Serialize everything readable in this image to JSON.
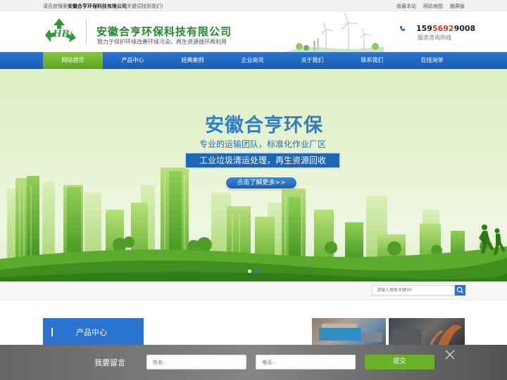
{
  "topbar": {
    "tip_prefix": "请百度搜索",
    "tip_company": "安徽合亨环保科技有限公司",
    "tip_suffix": "关键词找到我们!",
    "links": [
      "收藏本站",
      "网站地图",
      "触屏版"
    ]
  },
  "header": {
    "logo_text": "HB",
    "company_name": "安徽合亨环保科技有限公司",
    "slogan": "致力于保护环境改善环境污染，再生资源循环再利用",
    "phone_part1": "159",
    "phone_part2": "5692",
    "phone_part3": "9008",
    "phone_label": "服务咨询热线"
  },
  "nav": {
    "items": [
      "网站首页",
      "产品中心",
      "经典案例",
      "企业商讯",
      "关于我们",
      "联系我们",
      "在线询单"
    ],
    "active_index": 0
  },
  "banner": {
    "title": "安徽合亨环保",
    "subtitle": "专业的运输团队，标准化作业厂区",
    "box_text": "工业垃圾清运处理，再生资源回收",
    "button_label": "点击了解更多>>",
    "slide_count": 2,
    "active_slide": 1
  },
  "search": {
    "placeholder": "请输入搜索关键词!"
  },
  "products": {
    "section_title": "产品中心"
  },
  "message": {
    "title": "我要留言",
    "name_placeholder": "姓名:",
    "phone_placeholder": "电话:",
    "submit_label": "提交"
  },
  "colors": {
    "nav_blue": "#2a74cf",
    "active_green": "#6bb12a",
    "company_green": "#1f8a2a",
    "phone_highlight": "#d23a1f"
  },
  "icons": [
    "recycle-logo-icon",
    "phone-icon",
    "search-icon",
    "close-icon"
  ]
}
